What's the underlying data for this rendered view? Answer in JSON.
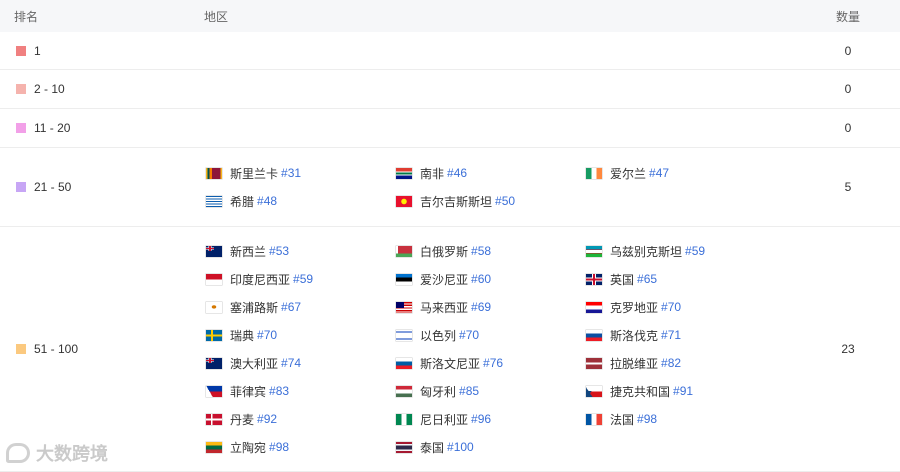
{
  "header": {
    "rank": "排名",
    "region": "地区",
    "count": "数量"
  },
  "rows": [
    {
      "rank": "1",
      "color": "#f08080",
      "count": "0",
      "regions": []
    },
    {
      "rank": "2 - 10",
      "color": "#f5b3ad",
      "count": "0",
      "regions": []
    },
    {
      "rank": "11 - 20",
      "color": "#f2a0e8",
      "count": "0",
      "regions": []
    },
    {
      "rank": "21 - 50",
      "color": "#c7a6f5",
      "count": "5",
      "regions": [
        {
          "name": "斯里兰卡",
          "rank": "#31",
          "flag": "lk"
        },
        {
          "name": "南非",
          "rank": "#46",
          "flag": "za"
        },
        {
          "name": "爱尔兰",
          "rank": "#47",
          "flag": "ie"
        },
        {
          "name": "希腊",
          "rank": "#48",
          "flag": "gr"
        },
        {
          "name": "吉尔吉斯斯坦",
          "rank": "#50",
          "flag": "kg"
        }
      ]
    },
    {
      "rank": "51 - 100",
      "color": "#fbc97f",
      "count": "23",
      "regions": [
        {
          "name": "新西兰",
          "rank": "#53",
          "flag": "nz"
        },
        {
          "name": "白俄罗斯",
          "rank": "#58",
          "flag": "by"
        },
        {
          "name": "乌兹别克斯坦",
          "rank": "#59",
          "flag": "uz"
        },
        {
          "name": "印度尼西亚",
          "rank": "#59",
          "flag": "id"
        },
        {
          "name": "爱沙尼亚",
          "rank": "#60",
          "flag": "ee"
        },
        {
          "name": "英国",
          "rank": "#65",
          "flag": "gb"
        },
        {
          "name": "塞浦路斯",
          "rank": "#67",
          "flag": "cy"
        },
        {
          "name": "马来西亚",
          "rank": "#69",
          "flag": "my"
        },
        {
          "name": "克罗地亚",
          "rank": "#70",
          "flag": "hr"
        },
        {
          "name": "瑞典",
          "rank": "#70",
          "flag": "se"
        },
        {
          "name": "以色列",
          "rank": "#70",
          "flag": "il"
        },
        {
          "name": "斯洛伐克",
          "rank": "#71",
          "flag": "sk"
        },
        {
          "name": "澳大利亚",
          "rank": "#74",
          "flag": "au"
        },
        {
          "name": "斯洛文尼亚",
          "rank": "#76",
          "flag": "si"
        },
        {
          "name": "拉脱维亚",
          "rank": "#82",
          "flag": "lv"
        },
        {
          "name": "菲律宾",
          "rank": "#83",
          "flag": "ph"
        },
        {
          "name": "匈牙利",
          "rank": "#85",
          "flag": "hu"
        },
        {
          "name": "捷克共和国",
          "rank": "#91",
          "flag": "cz"
        },
        {
          "name": "丹麦",
          "rank": "#92",
          "flag": "dk"
        },
        {
          "name": "尼日利亚",
          "rank": "#96",
          "flag": "ng"
        },
        {
          "name": "法国",
          "rank": "#98",
          "flag": "fr"
        },
        {
          "name": "立陶宛",
          "rank": "#98",
          "flag": "lt"
        },
        {
          "name": "泰国",
          "rank": "#100",
          "flag": "th"
        }
      ]
    }
  ],
  "watermark": "大数跨境"
}
